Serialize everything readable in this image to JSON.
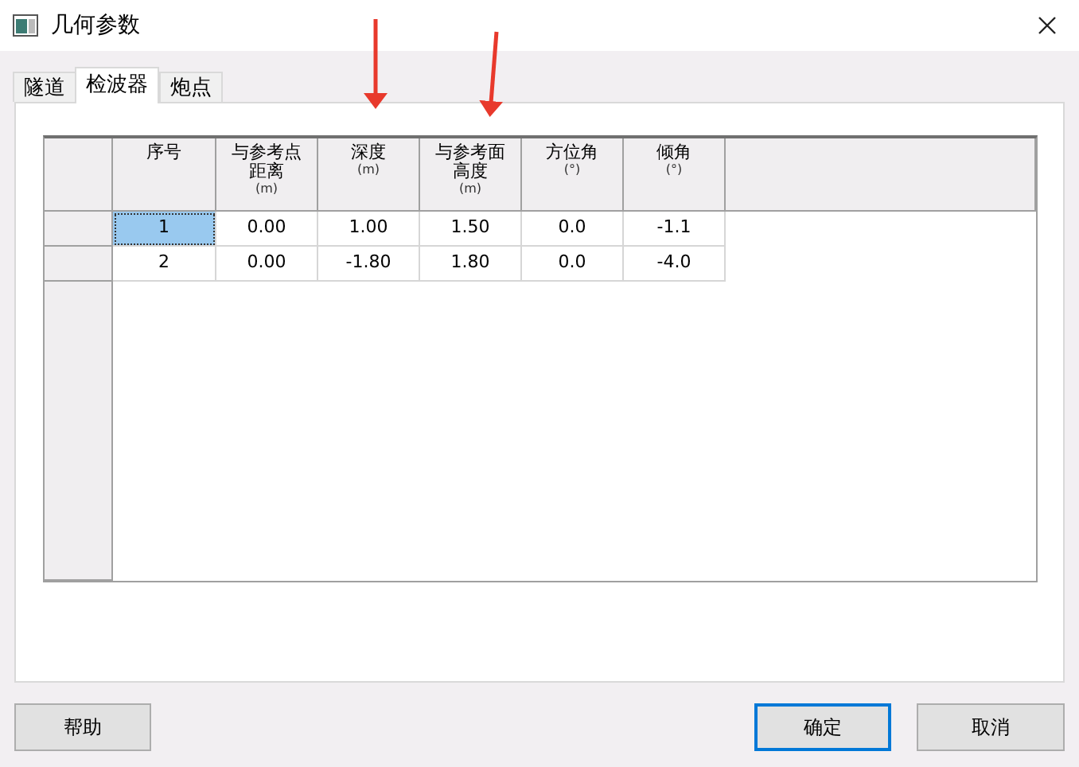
{
  "window": {
    "title": "几何参数"
  },
  "tabs": [
    {
      "label": "隧道",
      "selected": false
    },
    {
      "label": "检波器",
      "selected": true
    },
    {
      "label": "炮点",
      "selected": false
    }
  ],
  "table": {
    "columns": [
      {
        "name": "序号"
      },
      {
        "name": "与参考点距离",
        "unit": "(m)"
      },
      {
        "name": "深度",
        "unit": "(m)"
      },
      {
        "name": "与参考面高度",
        "unit": "(m)"
      },
      {
        "name": "方位角",
        "unit": "(°)"
      },
      {
        "name": "倾角",
        "unit": "(°)"
      }
    ],
    "rows": [
      {
        "cells": [
          {
            "text": "1",
            "selected": true
          },
          {
            "text": "0.00",
            "selected": false
          },
          {
            "text": "1.00",
            "selected": false
          },
          {
            "text": "1.50",
            "selected": false
          },
          {
            "text": "0.0",
            "selected": false
          },
          {
            "text": "-1.1",
            "selected": false
          }
        ]
      },
      {
        "cells": [
          {
            "text": "2",
            "selected": false
          },
          {
            "text": "0.00",
            "selected": false
          },
          {
            "text": "-1.80",
            "selected": false
          },
          {
            "text": "1.80",
            "selected": false
          },
          {
            "text": "0.0",
            "selected": false
          },
          {
            "text": "-4.0",
            "selected": false
          }
        ]
      }
    ]
  },
  "buttons": [
    {
      "label": "帮助",
      "default": false
    },
    {
      "label": "确定",
      "default": true
    },
    {
      "label": "取消",
      "default": false
    }
  ]
}
